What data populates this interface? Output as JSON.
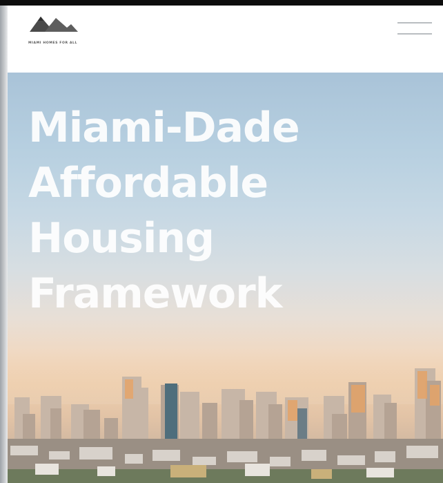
{
  "header": {
    "logo_text": "MIAMI HOMES FOR ALL",
    "logo_icon": "mountain-roof-logo",
    "menu_icon": "hamburger-menu-icon"
  },
  "hero": {
    "title_lines": [
      "Miami-Dade",
      "Affordable",
      "Housing",
      "Framework"
    ]
  },
  "colors": {
    "top_bar": "#0d0d0d",
    "header_bg": "#ffffff",
    "menu_bars": "#b9bdc1",
    "title_text": "#ffffff"
  }
}
